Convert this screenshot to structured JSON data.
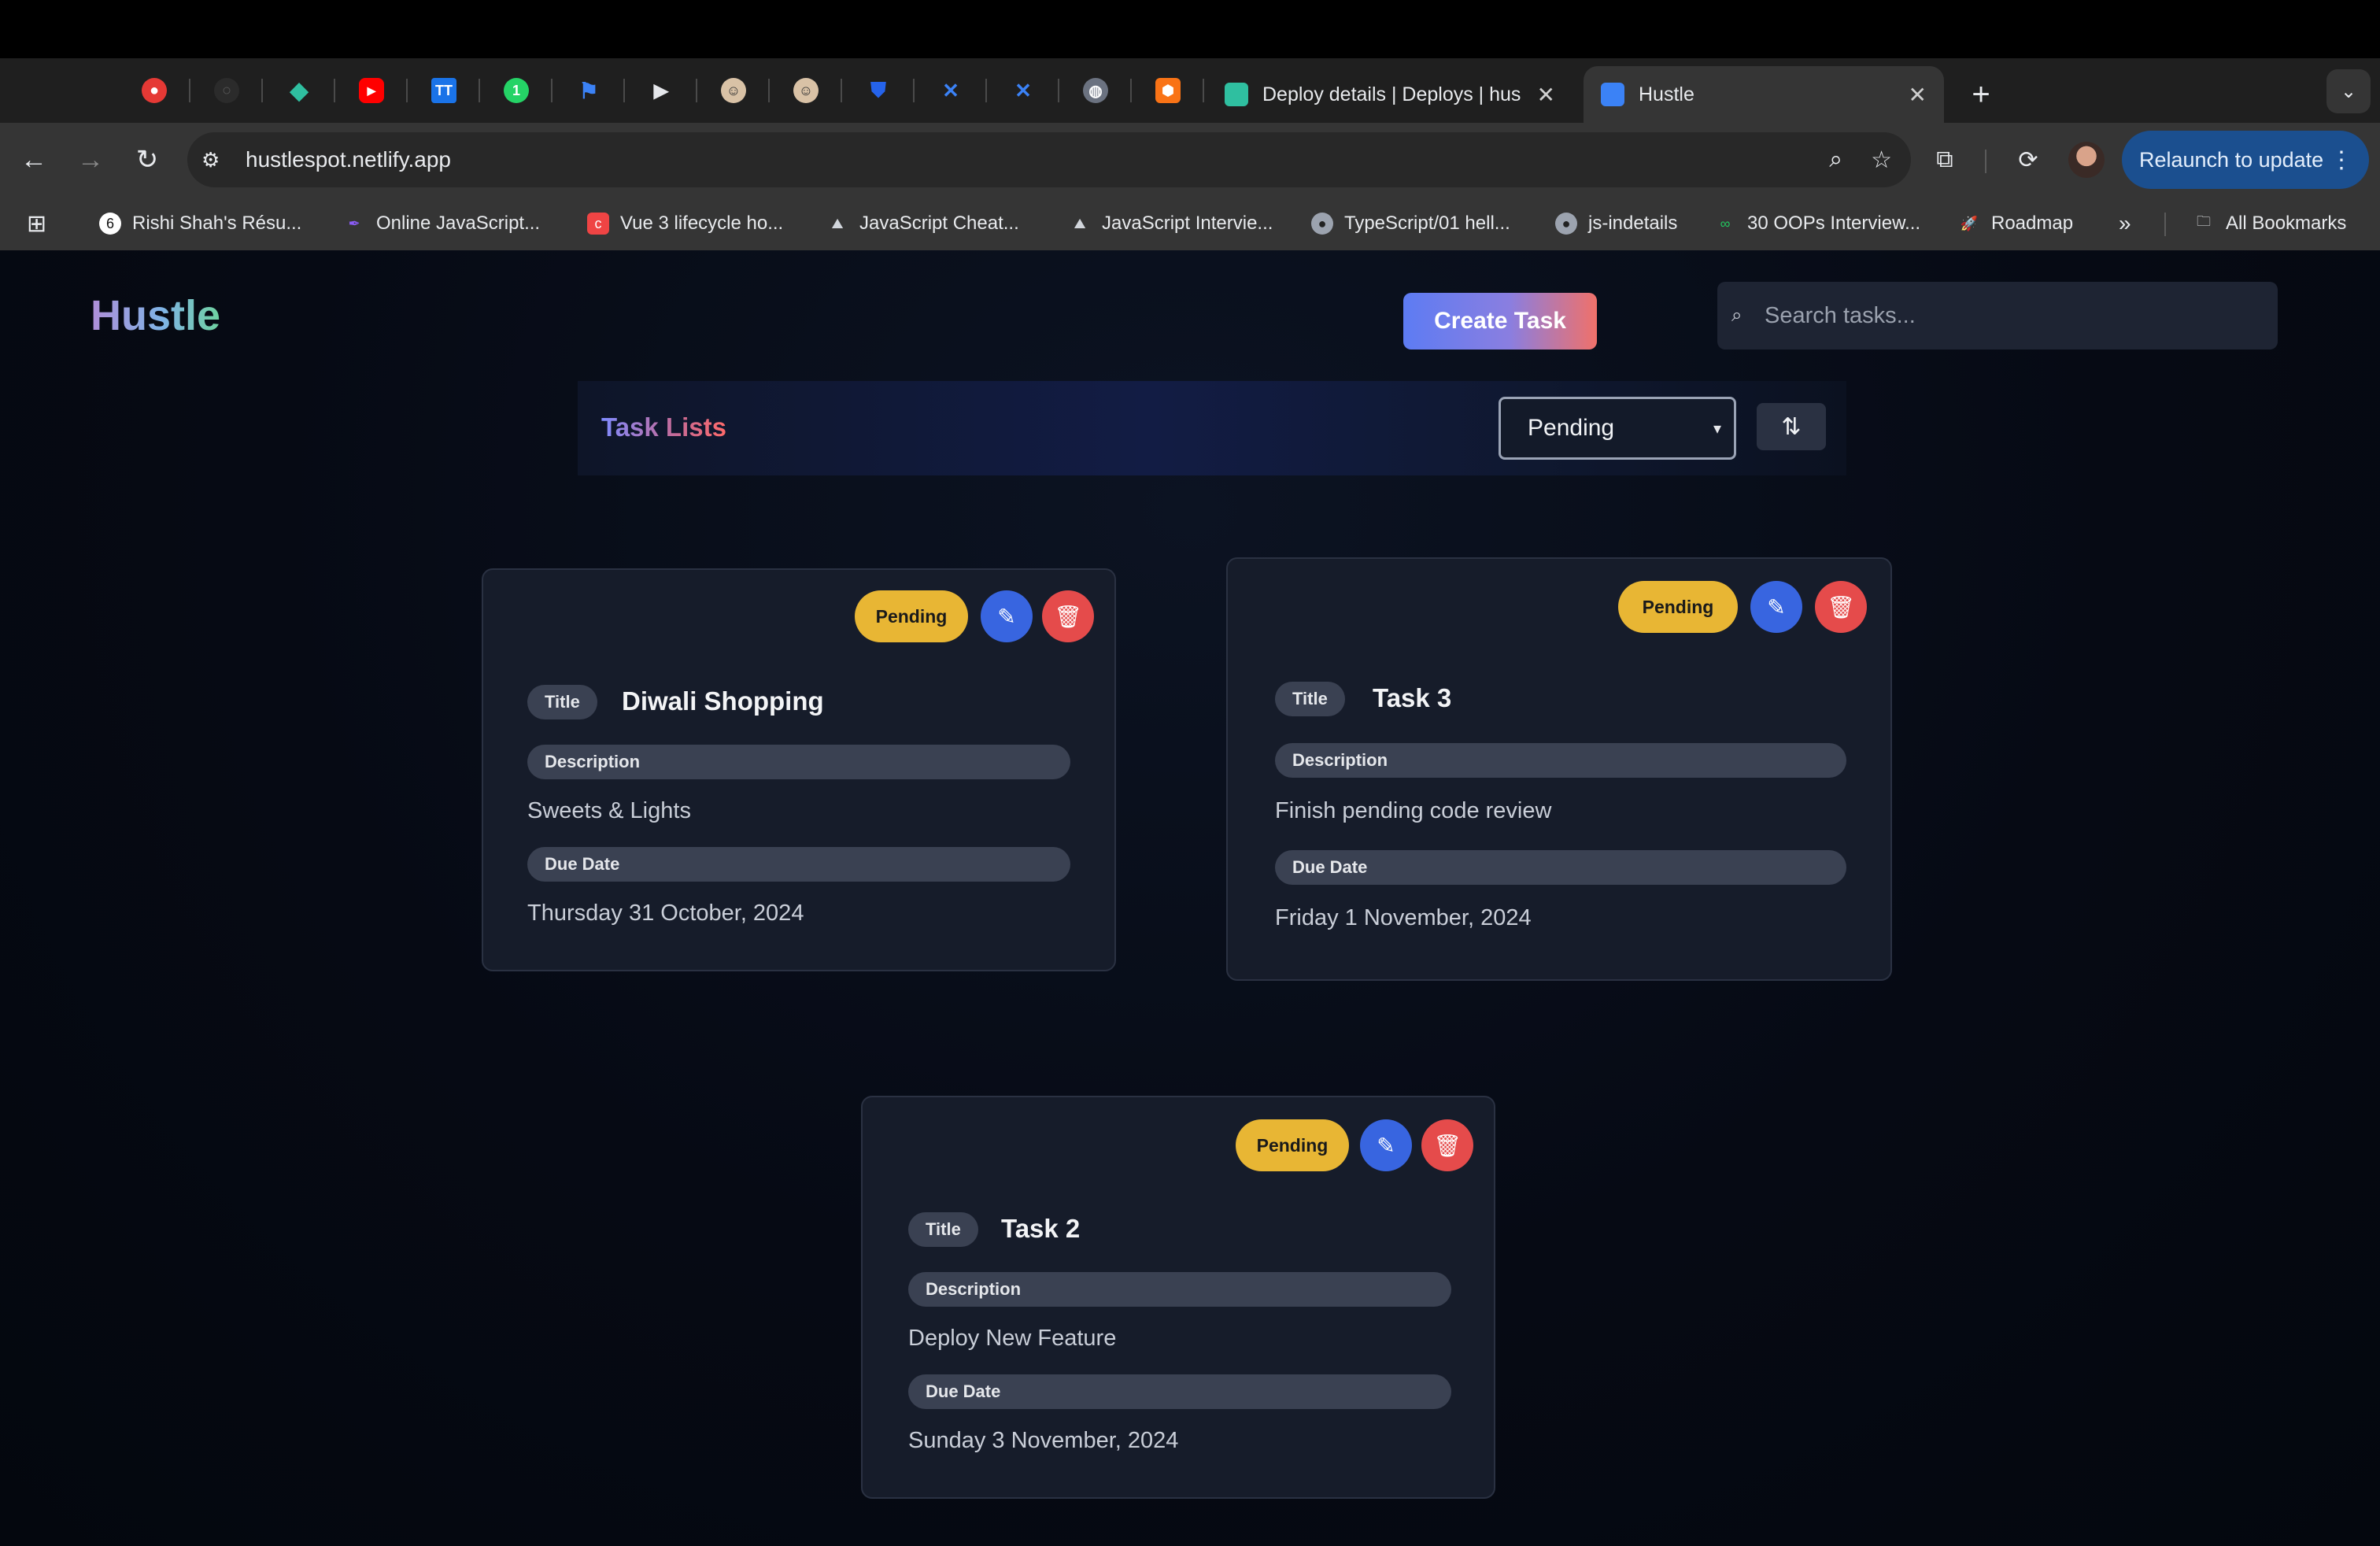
{
  "browser": {
    "pinned_tabs": [
      {
        "icon": "youtube-music-icon",
        "color": "#e53935"
      },
      {
        "icon": "github-icon",
        "color": "#3a3a3a"
      },
      {
        "icon": "netlify-icon",
        "color": "#2fbfa0"
      },
      {
        "icon": "youtube-icon",
        "color": "#ff0000"
      },
      {
        "icon": "tt-app-icon",
        "color": "#1a73e8"
      },
      {
        "icon": "whatsapp-icon",
        "color": "#25d366"
      },
      {
        "icon": "flag-icon",
        "color": "#3b82f6"
      },
      {
        "icon": "play-icon",
        "color": "#222222"
      },
      {
        "icon": "person-avatar-icon",
        "color": "#d9c2a6"
      },
      {
        "icon": "person-avatar-icon",
        "color": "#d9c2a6"
      },
      {
        "icon": "shield-icon",
        "color": "#2563eb"
      },
      {
        "icon": "jira-icon",
        "color": "#1e40af"
      },
      {
        "icon": "jira-icon",
        "color": "#1e40af"
      },
      {
        "icon": "globe-icon",
        "color": "#6b7280"
      },
      {
        "icon": "box-icon",
        "color": "#f97316"
      }
    ],
    "tabs": [
      {
        "title": "Deploy details | Deploys | hus",
        "active": false
      },
      {
        "title": "Hustle",
        "active": true
      }
    ],
    "url": "hustlespot.netlify.app",
    "relaunch_label": "Relaunch to update",
    "bookmarks": [
      {
        "label": "Rishi Shah's Résu...",
        "icon": "logo-icon",
        "color": "#ffffff"
      },
      {
        "label": "Online JavaScript...",
        "icon": "feather-icon",
        "color": "#8b5cf6"
      },
      {
        "label": "Vue 3 lifecycle ho...",
        "icon": "c-icon",
        "color": "#ef4444"
      },
      {
        "label": "JavaScript Cheat...",
        "icon": "mountain-icon",
        "color": "#d1d5db"
      },
      {
        "label": "JavaScript Intervie...",
        "icon": "mountain-icon",
        "color": "#d1d5db"
      },
      {
        "label": "TypeScript/01 hell...",
        "icon": "github-icon",
        "color": "#9ca3af"
      },
      {
        "label": "js-indetails",
        "icon": "github-icon",
        "color": "#9ca3af"
      },
      {
        "label": "30 OOPs Interview...",
        "icon": "link-icon",
        "color": "#22c55e"
      },
      {
        "label": "Roadmap",
        "icon": "rocket-icon",
        "color": "#f97316"
      }
    ],
    "all_bookmarks_label": "All Bookmarks"
  },
  "app": {
    "brand": "Hustle",
    "create_task_label": "Create Task",
    "search_placeholder": "Search tasks...",
    "list_title": "Task Lists",
    "filter_selected": "Pending"
  },
  "tasks": [
    {
      "status": "Pending",
      "title_label": "Title",
      "title": "Diwali Shopping",
      "description_label": "Description",
      "description": "Sweets & Lights",
      "due_label": "Due Date",
      "due": "Thursday 31 October, 2024"
    },
    {
      "status": "Pending",
      "title_label": "Title",
      "title": "Task 3",
      "description_label": "Description",
      "description": "Finish pending code review",
      "due_label": "Due Date",
      "due": "Friday 1 November, 2024"
    },
    {
      "status": "Pending",
      "title_label": "Title",
      "title": "Task 2",
      "description_label": "Description",
      "description": "Deploy New Feature",
      "due_label": "Due Date",
      "due": "Sunday 3 November, 2024"
    }
  ]
}
